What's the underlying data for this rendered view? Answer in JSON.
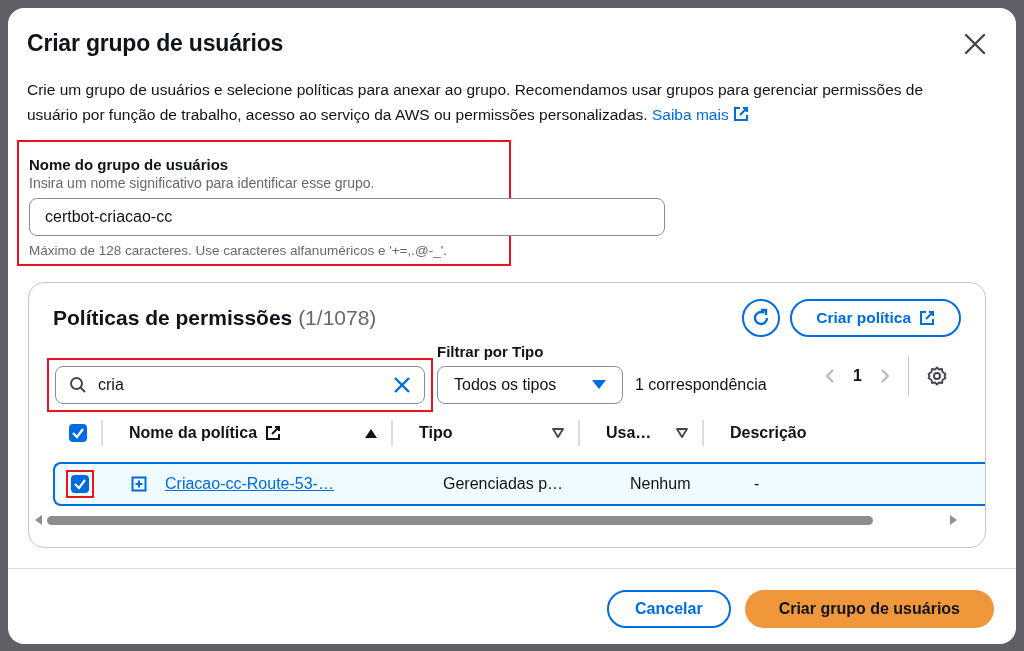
{
  "dialog": {
    "title": "Criar grupo de usuários",
    "description": "Crie um grupo de usuários e selecione políticas para anexar ao grupo. Recomendamos usar grupos para gerenciar permissões de usuário por função de trabalho, acesso ao serviço da AWS ou permissões personalizadas.",
    "learn_more": "Saiba mais"
  },
  "group_name": {
    "label": "Nome do grupo de usuários",
    "hint": "Insira um nome significativo para identificar esse grupo.",
    "value": "certbot-criacao-cc",
    "constraint": "Máximo de 128 caracteres. Use caracteres alfanuméricos e '+=,.@-_'.",
    "highlighted": true
  },
  "policies": {
    "title": "Políticas de permissões",
    "count": "(1/1078)",
    "create_button": "Criar política",
    "search": {
      "value": "cria",
      "highlighted": true
    },
    "filter": {
      "label": "Filtrar por Tipo",
      "value": "Todos os tipos"
    },
    "matches": "1 correspondência",
    "page": "1",
    "columns": [
      {
        "label": "Nome da política",
        "kind": "sort"
      },
      {
        "label": "Tipo",
        "kind": "filter"
      },
      {
        "label": "Usa…",
        "kind": "filter"
      },
      {
        "label": "Descrição",
        "kind": "plain"
      }
    ],
    "select_all": {
      "checked": true
    },
    "rows": [
      {
        "selected": true,
        "checked": true,
        "highlighted": true,
        "name": "Criacao-cc-Route-53-…",
        "type": "Gerenciadas p…",
        "used": "Nenhum",
        "description": "-"
      }
    ]
  },
  "buttons": {
    "cancel": "Cancelar",
    "submit": "Criar grupo de usuários"
  }
}
